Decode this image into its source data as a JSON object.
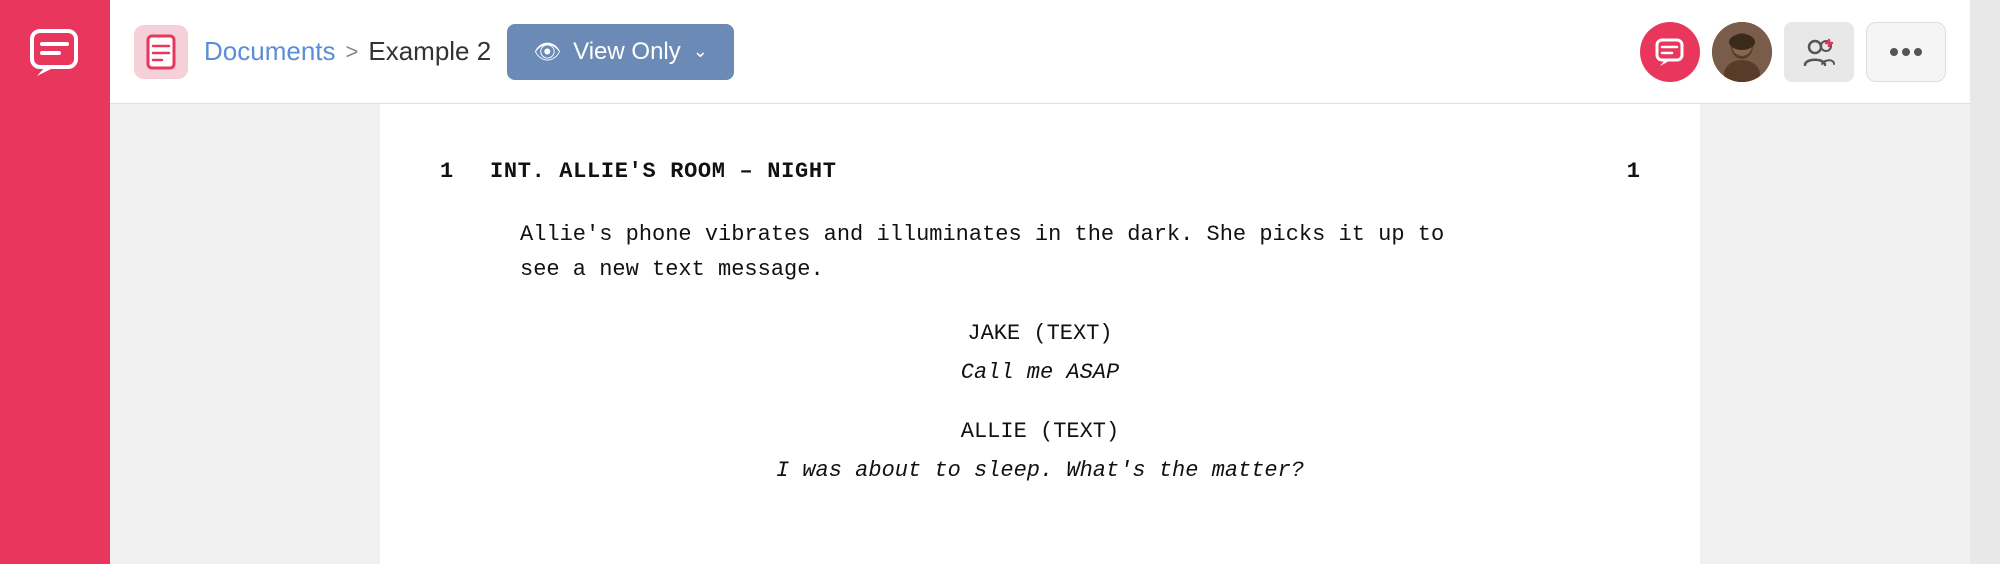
{
  "sidebar": {
    "icon_label": "chat-bubble-icon"
  },
  "header": {
    "doc_icon_label": "document-icon",
    "breadcrumb": {
      "documents_label": "Documents",
      "separator": ">",
      "current": "Example 2"
    },
    "view_only_button": {
      "label": "View Only",
      "eye": "👁",
      "chevron": "∨"
    },
    "actions": {
      "chat_label": "chat-action-icon",
      "users_label": "users-icon",
      "more_label": "more-options-button"
    }
  },
  "document": {
    "scene_number_left": "1",
    "scene_number_right": "1",
    "scene_heading": "INT. ALLIE'S ROOM – NIGHT",
    "action": "Allie's phone vibrates and illuminates in the dark. She picks it up to\nsee a new text message.",
    "dialogue": [
      {
        "character": "JAKE (TEXT)",
        "line": "Call me ASAP"
      },
      {
        "character": "ALLIE (TEXT)",
        "line": "I was about to sleep. What's the matter?"
      }
    ]
  }
}
